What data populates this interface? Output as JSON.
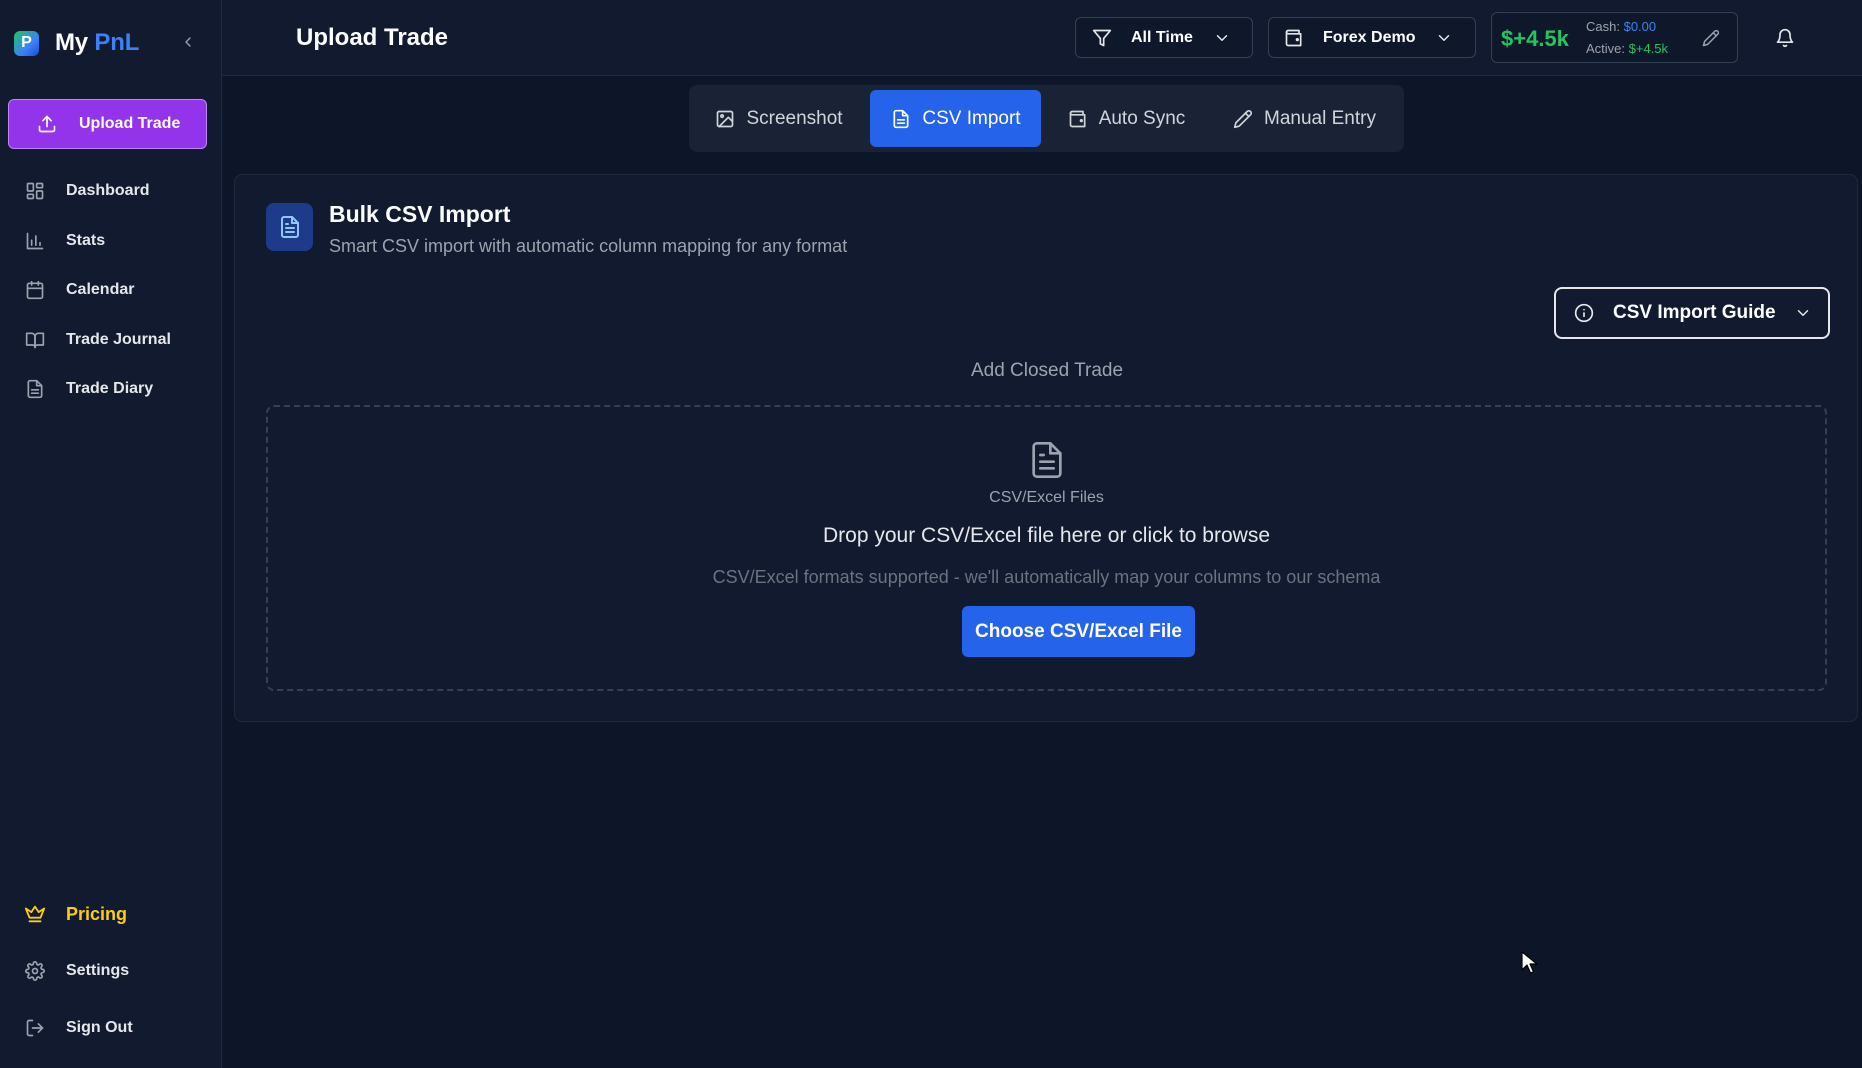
{
  "brand": {
    "logo_letter": "P",
    "name_part1": "My",
    "name_part2": "PnL"
  },
  "sidebar": {
    "upload_label": "Upload Trade",
    "items": [
      {
        "label": "Dashboard",
        "icon": "dashboard-icon"
      },
      {
        "label": "Stats",
        "icon": "bar-chart-icon"
      },
      {
        "label": "Calendar",
        "icon": "calendar-icon"
      },
      {
        "label": "Trade Journal",
        "icon": "book-open-icon"
      },
      {
        "label": "Trade Diary",
        "icon": "file-text-icon"
      }
    ],
    "pricing_label": "Pricing",
    "settings_label": "Settings",
    "signout_label": "Sign Out"
  },
  "header": {
    "title": "Upload Trade",
    "time_filter": "All Time",
    "account": "Forex Demo",
    "pnl_total": "$+4.5k",
    "cash_label": "Cash:",
    "cash_value": "$0.00",
    "active_label": "Active:",
    "active_value": "$+4.5k"
  },
  "tabs": [
    {
      "label": "Screenshot",
      "icon": "image-icon",
      "active": false
    },
    {
      "label": "CSV Import",
      "icon": "file-text-icon",
      "active": true
    },
    {
      "label": "Auto Sync",
      "icon": "wallet-icon",
      "active": false
    },
    {
      "label": "Manual Entry",
      "icon": "pencil-icon",
      "active": false
    }
  ],
  "card": {
    "title": "Bulk CSV Import",
    "subtitle": "Smart CSV import with automatic column mapping for any format",
    "guide_label": "CSV Import Guide",
    "section_label": "Add Closed Trade",
    "dropzone": {
      "file_type_label": "CSV/Excel Files",
      "main_text": "Drop your CSV/Excel file here or click to browse",
      "sub_text": "CSV/Excel formats supported - we'll automatically map your columns to our schema",
      "button_label": "Choose CSV/Excel File"
    }
  },
  "colors": {
    "accent_purple": "#9333ea",
    "accent_blue": "#2563eb",
    "positive_green": "#22c55e",
    "pricing_yellow": "#facc15",
    "background": "#0d1628"
  }
}
